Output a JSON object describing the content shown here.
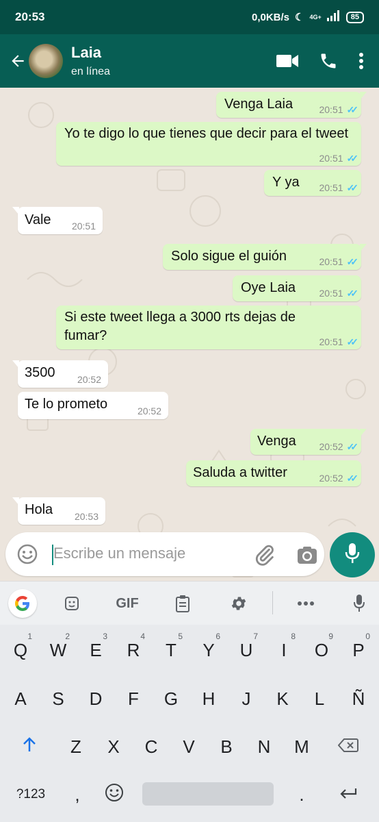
{
  "status_bar": {
    "time": "20:53",
    "network": "0,0KB/s",
    "signal": "4G+",
    "battery": "85"
  },
  "header": {
    "name": "Laia",
    "status": "en línea"
  },
  "messages": [
    {
      "dir": "out",
      "text": "Venga Laia",
      "time": "20:51"
    },
    {
      "dir": "out",
      "text": "Yo te digo lo que tienes que decir para el tweet",
      "time": "20:51"
    },
    {
      "dir": "out",
      "text": "Y ya",
      "time": "20:51"
    },
    {
      "dir": "in",
      "text": "Vale",
      "time": "20:51"
    },
    {
      "dir": "out",
      "text": "Solo sigue el guión",
      "time": "20:51"
    },
    {
      "dir": "out",
      "text": "Oye Laia",
      "time": "20:51"
    },
    {
      "dir": "out",
      "text": "Si este tweet llega a 3000 rts dejas de fumar?",
      "time": "20:51"
    },
    {
      "dir": "in",
      "text": "3500",
      "time": "20:52"
    },
    {
      "dir": "in",
      "text": "Te lo prometo",
      "time": "20:52"
    },
    {
      "dir": "out",
      "text": "Venga",
      "time": "20:52"
    },
    {
      "dir": "out",
      "text": "Saluda a twitter",
      "time": "20:52"
    },
    {
      "dir": "in",
      "text": "Hola",
      "time": "20:53"
    }
  ],
  "input": {
    "placeholder": "Escribe un mensaje"
  },
  "keyboard": {
    "toolbar": {
      "gif": "GIF"
    },
    "row1": [
      "Q",
      "W",
      "E",
      "R",
      "T",
      "Y",
      "U",
      "I",
      "O",
      "P"
    ],
    "row1_hints": [
      "1",
      "2",
      "3",
      "4",
      "5",
      "6",
      "7",
      "8",
      "9",
      "0"
    ],
    "row2": [
      "A",
      "S",
      "D",
      "F",
      "G",
      "H",
      "J",
      "K",
      "L",
      "Ñ"
    ],
    "row3": [
      "Z",
      "X",
      "C",
      "V",
      "B",
      "N",
      "M"
    ],
    "symbols_label": "?123",
    "comma": ",",
    "period": "."
  },
  "colors": {
    "header": "#075e54",
    "status_bar": "#054d44",
    "outgoing": "#dcf8c6",
    "incoming": "#ffffff",
    "accent": "#128c7e",
    "read_ticks": "#4fc3f7"
  }
}
